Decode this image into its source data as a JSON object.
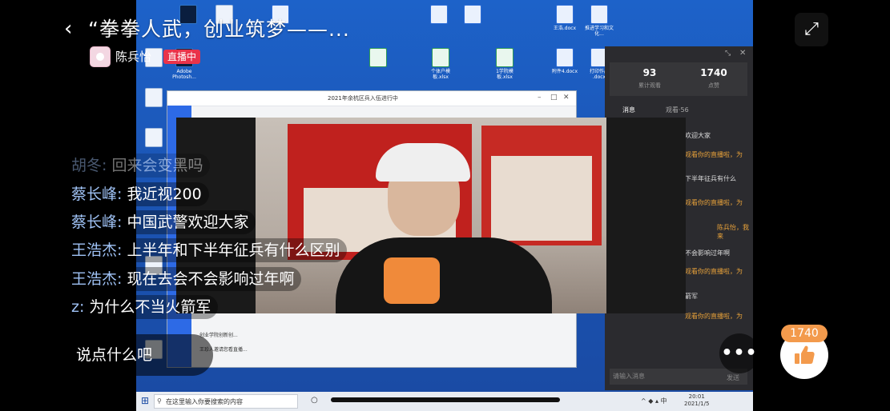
{
  "header": {
    "back_icon": "chevron-left-icon",
    "title": "“拳拳人武，创业筑梦——...",
    "host_name": "陈兵怡",
    "live_badge": "直播中",
    "top_right_icon": "screen-rotate-icon"
  },
  "comments": [
    {
      "user": "胡冬:",
      "text": "回来会变黑吗"
    },
    {
      "user": "蔡长峰:",
      "text": "我近视200"
    },
    {
      "user": "蔡长峰:",
      "text": "中国武警欢迎大家"
    },
    {
      "user": "王浩杰:",
      "text": "上半年和下半年征兵有什么区别"
    },
    {
      "user": "王浩杰:",
      "text": "现在去会不会影响过年啊"
    },
    {
      "user": "z:",
      "text": "为什么不当火箭军"
    }
  ],
  "bottom": {
    "say_placeholder": "说点什么吧",
    "more_icon": "more-horizontal-icon",
    "like_icon": "thumbs-up-icon",
    "like_count": "1740"
  },
  "shared_screen": {
    "panel": {
      "viewers": "93",
      "viewers_label": "累计观看",
      "likes": "1740",
      "likes_label": "点赞",
      "tab_messages": "消息",
      "tab_watch": "观看·56",
      "messages": [
        {
          "text": "欢迎大家",
          "style": "normal"
        },
        {
          "text": "观看你的直播啦，为",
          "style": "orange"
        },
        {
          "text": "下半年征兵有什么",
          "style": "normal"
        },
        {
          "text": "观看你的直播啦，为",
          "style": "orange"
        },
        {
          "text": "陈兵怡，我来",
          "style": "orange"
        },
        {
          "text": "不会影响过年啊",
          "style": "normal"
        },
        {
          "text": "观看你的直播啦，为",
          "style": "orange"
        },
        {
          "text": "箭军",
          "style": "normal"
        },
        {
          "text": "观看你的直播啦，为",
          "style": "orange"
        }
      ],
      "input_placeholder": "请输入消息",
      "send_label": "发送"
    },
    "taskbar": {
      "search_placeholder": "在这里输入你要搜索的内容",
      "time": "20:01",
      "date": "2021/1/5",
      "ime": "中"
    },
    "app_window": {
      "title": "2021年余杭区兵入伍进行中",
      "list_items": [
        "创业学院创新创...",
        "王珍人邀请您看直播..."
      ]
    },
    "desktop_icons": [
      "Adobe Photosh...",
      "王浩.docx",
      "附件4.docx",
      "打印作品 .docx",
      "个体户模板.xlsx",
      "1学院模板.xlsx",
      "推进学习和文化..."
    ]
  }
}
